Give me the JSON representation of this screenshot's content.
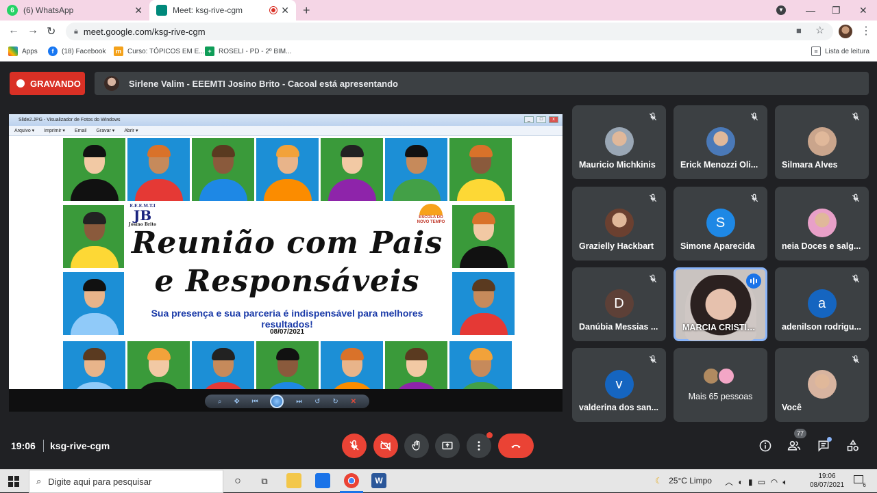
{
  "browser": {
    "tabs": [
      {
        "title": "(6) WhatsApp",
        "badge": "6"
      },
      {
        "title": "Meet: ksg-rive-cgm"
      }
    ],
    "url": "meet.google.com/ksg-rive-cgm",
    "bookmarks": [
      {
        "label": "Apps"
      },
      {
        "label": "(18) Facebook"
      },
      {
        "label": "Curso: TÓPICOS EM E..."
      },
      {
        "label": "ROSELI - PD - 2º BIM..."
      }
    ],
    "reading_list": "Lista de leitura"
  },
  "meet": {
    "recording_label": "GRAVANDO",
    "presenting_text": "Sirlene Valim - EEEMTI Josino Brito - Cacoal está apresentando",
    "clock": "19:06",
    "meeting_code": "ksg-rive-cgm",
    "people_count": "77"
  },
  "presentation": {
    "viewer_title": "Slide2.JPG - Visualizador de Fotos do Windows",
    "menu": [
      "Arquivo ▾",
      "Imprimir ▾",
      "Email",
      "Gravar ▾",
      "Abrir ▾"
    ],
    "logo_left": {
      "line1": "E.E.E.M.T.I",
      "line2": "JB",
      "line3": "Josino Brito"
    },
    "logo_right": {
      "line1": "ESCOLA DO",
      "line2": "NOVO TEMPO"
    },
    "headline_1": "Reunião com Pais",
    "headline_2": "e Responsáveis",
    "subtitle": "Sua presença e sua parceria é indispensável para melhores resultados!",
    "date": "08/07/2021"
  },
  "participants": [
    {
      "name": "Mauricio Michkinis",
      "avatar": "photo",
      "color": "#9aa7b5"
    },
    {
      "name": "Erick Menozzi Oli...",
      "avatar": "photo",
      "color": "#4a79b8"
    },
    {
      "name": "Silmara Alves",
      "avatar": "photo",
      "color": "#caa58c"
    },
    {
      "name": "Grazielly Hackbart",
      "avatar": "photo",
      "color": "#6b4030"
    },
    {
      "name": "Simone Aparecida",
      "avatar": "S",
      "color": "#1e88e5"
    },
    {
      "name": "neia Doces e salg...",
      "avatar": "photo",
      "color": "#e8a0c8"
    },
    {
      "name": "Danúbia Messias ...",
      "avatar": "D",
      "color": "#5d4037"
    },
    {
      "name": "MARCIA CRISTIA...",
      "avatar": "camera",
      "color": "#c9c3c0"
    },
    {
      "name": "adenilson rodrigu...",
      "avatar": "a",
      "color": "#1565c0"
    },
    {
      "name": "valderina dos san...",
      "avatar": "v",
      "color": "#1565c0"
    },
    {
      "name": "Mais 65 pessoas",
      "avatar": "group",
      "color": "#3c4043"
    },
    {
      "name": "Você",
      "avatar": "photo",
      "color": "#d8b4a0"
    }
  ],
  "taskbar": {
    "search_placeholder": "Digite aqui para pesquisar",
    "weather": "25°C  Limpo",
    "time": "19:06",
    "date": "08/07/2021",
    "notifications": "6"
  }
}
